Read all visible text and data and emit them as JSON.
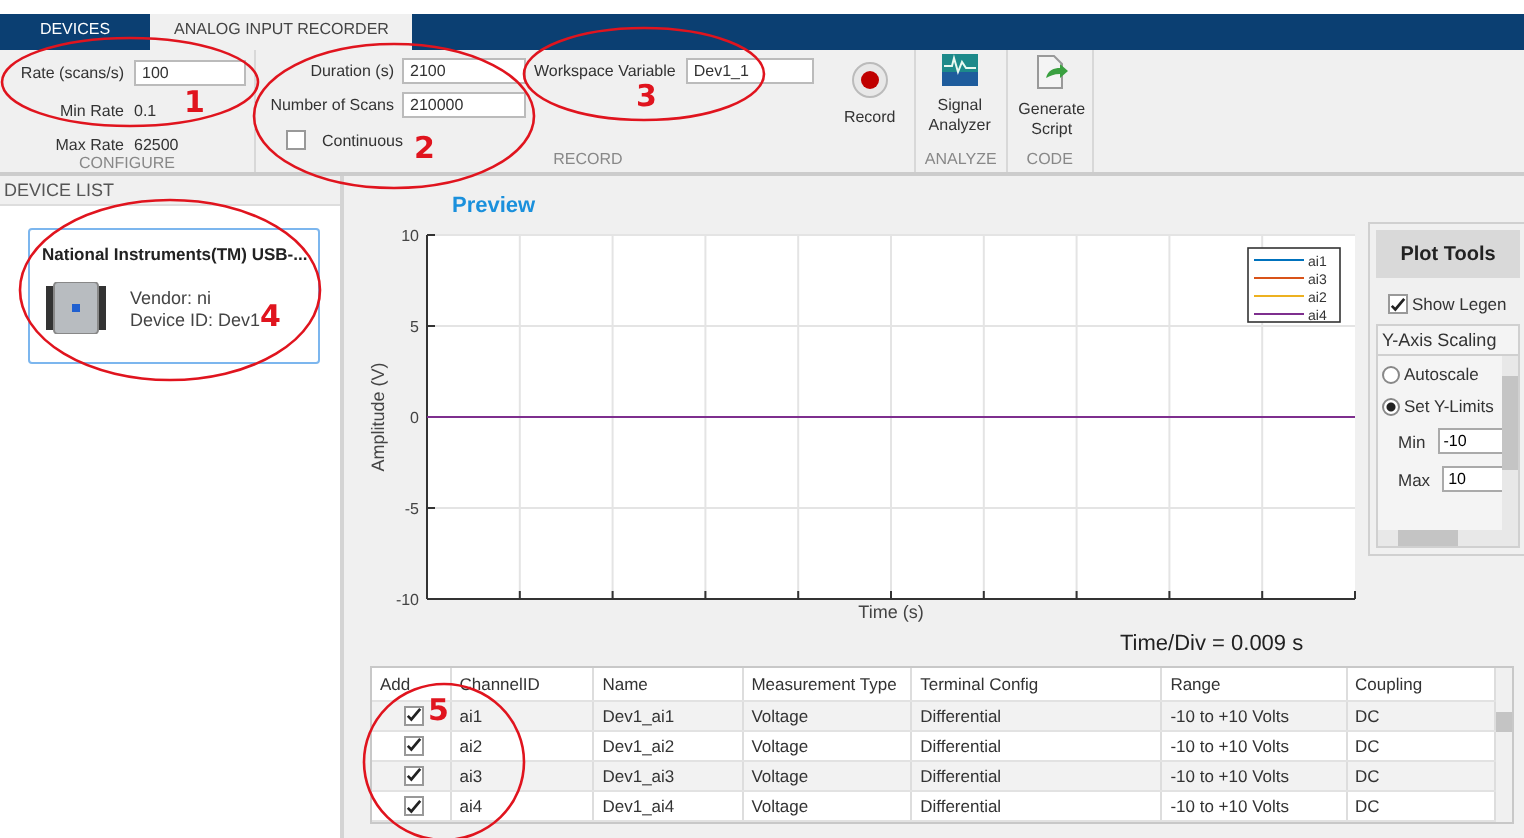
{
  "tabs": [
    {
      "label": "DEVICES",
      "selected": false
    },
    {
      "label": "ANALOG INPUT RECORDER",
      "selected": true
    }
  ],
  "configure": {
    "title": "CONFIGURE",
    "rate": {
      "label": "Rate (scans/s)",
      "value": "100"
    },
    "readouts": [
      {
        "label": "Min Rate",
        "value": "0.1"
      },
      {
        "label": "Max Rate",
        "value": "62500"
      }
    ]
  },
  "record": {
    "title": "RECORD",
    "fields": [
      {
        "label": "Duration (s)",
        "value": "2100"
      },
      {
        "label": "Number of Scans",
        "value": "210000"
      }
    ],
    "continuous": {
      "label": "Continuous",
      "checked": false
    },
    "workspace": {
      "label": "Workspace Variable",
      "value": "Dev1_1"
    },
    "record_button": "Record"
  },
  "analyze": {
    "title": "ANALYZE",
    "button": "Signal Analyzer"
  },
  "code": {
    "title": "CODE",
    "button": "Generate Script"
  },
  "device_list": {
    "title": "DEVICE LIST",
    "device": {
      "name": "National Instruments(TM) USB-...",
      "vendor": "Vendor: ni",
      "device_id": "Device ID: Dev1"
    }
  },
  "preview": {
    "title": "Preview",
    "chart_data": {
      "type": "line",
      "xlabel": "Time (s)",
      "ylabel": "Amplitude (V)",
      "ylim": [
        -10,
        10
      ],
      "yticks": [
        -10,
        -5,
        0,
        5,
        10
      ],
      "legend": true,
      "grid": true,
      "series": [
        {
          "name": "ai1",
          "color": "#0072bd"
        },
        {
          "name": "ai3",
          "color": "#d95319"
        },
        {
          "name": "ai2",
          "color": "#edb120"
        },
        {
          "name": "ai4",
          "color": "#7e2f8e",
          "values": [
            0,
            0,
            0,
            0,
            0,
            0,
            0,
            0,
            0,
            0,
            0
          ]
        }
      ]
    },
    "time_div": "Time/Div = 0.009 s"
  },
  "plot_tools": {
    "title": "Plot Tools",
    "show_legend": {
      "label": "Show Legen",
      "checked": true
    },
    "y_axis_scaling": {
      "title": "Y-Axis Scaling",
      "options": [
        {
          "label": "Autoscale",
          "selected": false
        },
        {
          "label": "Set Y-Limits",
          "selected": true
        }
      ],
      "min": {
        "label": "Min",
        "value": "-10"
      },
      "max": {
        "label": "Max",
        "value": "10"
      }
    }
  },
  "table": {
    "add_column": "Add",
    "columns": [
      "ChannelID",
      "Name",
      "Measurement Type",
      "Terminal Config",
      "Range",
      "Coupling"
    ],
    "rows": [
      {
        "add": true,
        "cells": [
          "ai1",
          "Dev1_ai1",
          "Voltage",
          "Differential",
          "-10 to +10 Volts",
          "DC"
        ]
      },
      {
        "add": true,
        "cells": [
          "ai2",
          "Dev1_ai2",
          "Voltage",
          "Differential",
          "-10 to +10 Volts",
          "DC"
        ]
      },
      {
        "add": true,
        "cells": [
          "ai3",
          "Dev1_ai3",
          "Voltage",
          "Differential",
          "-10 to +10 Volts",
          "DC"
        ]
      },
      {
        "add": true,
        "cells": [
          "ai4",
          "Dev1_ai4",
          "Voltage",
          "Differential",
          "-10 to +10 Volts",
          "DC"
        ]
      }
    ]
  },
  "annotations": [
    {
      "number": "1"
    },
    {
      "number": "2"
    },
    {
      "number": "3"
    },
    {
      "number": "4"
    },
    {
      "number": "5"
    }
  ]
}
